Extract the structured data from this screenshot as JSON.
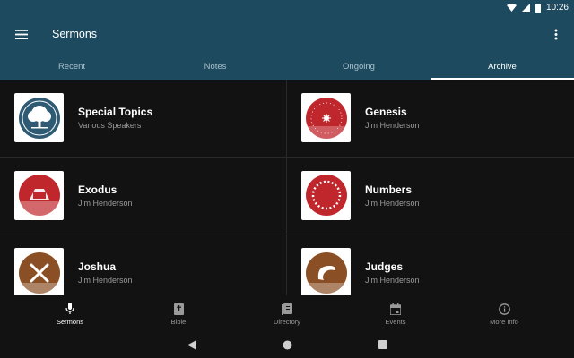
{
  "status": {
    "time": "10:26"
  },
  "appbar": {
    "title": "Sermons"
  },
  "tabs": [
    {
      "label": "Recent"
    },
    {
      "label": "Notes"
    },
    {
      "label": "Ongoing"
    },
    {
      "label": "Archive"
    }
  ],
  "series": [
    {
      "title": "Special Topics",
      "speaker": "Various Speakers",
      "icon": "tree-icon",
      "color": "#2e5b73"
    },
    {
      "title": "Genesis",
      "speaker": "Jim Henderson",
      "icon": "star-icon",
      "color": "#c0272d"
    },
    {
      "title": "Exodus",
      "speaker": "Jim Henderson",
      "icon": "tablets-icon",
      "color": "#c0272d"
    },
    {
      "title": "Numbers",
      "speaker": "Jim Henderson",
      "icon": "tribes-icon",
      "color": "#c0272d"
    },
    {
      "title": "Joshua",
      "speaker": "Jim Henderson",
      "icon": "swords-icon",
      "color": "#8a4f24"
    },
    {
      "title": "Judges",
      "speaker": "Jim Henderson",
      "icon": "horn-icon",
      "color": "#8a4f24"
    }
  ],
  "bottomnav": [
    {
      "label": "Sermons"
    },
    {
      "label": "Bible"
    },
    {
      "label": "Directory"
    },
    {
      "label": "Events"
    },
    {
      "label": "More Info"
    }
  ]
}
